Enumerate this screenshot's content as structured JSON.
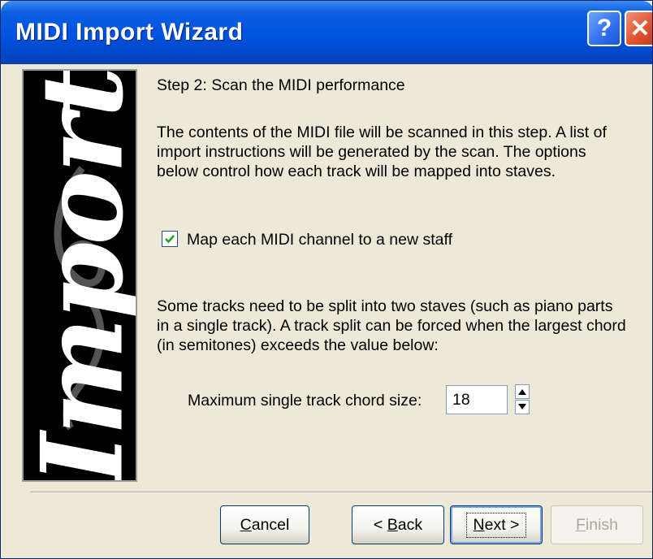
{
  "window": {
    "title": "MIDI Import Wizard",
    "help_glyph": "?",
    "close_glyph": "✕"
  },
  "side_panel": {
    "word": "Import"
  },
  "content": {
    "step_title": "Step 2: Scan the MIDI performance",
    "description": "The contents of the MIDI file will be scanned in this step. A list of import instructions will be generated by the scan. The options below control how each track will be mapped into staves.",
    "map_channel_checkbox": {
      "label": "Map each MIDI channel to a new staff",
      "checked": true
    },
    "split_description": "Some tracks need to be split into two staves (such as piano parts in a single track). A track split can be forced when the largest chord (in semitones) exceeds the value below:",
    "chord_size": {
      "label": "Maximum single track chord size:",
      "value": "18"
    }
  },
  "buttons": {
    "cancel": {
      "mnemonic": "C",
      "rest": "ancel"
    },
    "back": {
      "prefix": "< ",
      "mnemonic": "B",
      "rest": "ack"
    },
    "next": {
      "mnemonic": "N",
      "rest": "ext >"
    },
    "finish": {
      "mnemonic": "F",
      "rest": "inish",
      "enabled": false
    }
  },
  "colors": {
    "titlebar": "#0054e3",
    "dialog_background": "#ece9d8",
    "checkmark": "#21a121",
    "disabled_text": "#aca899"
  }
}
